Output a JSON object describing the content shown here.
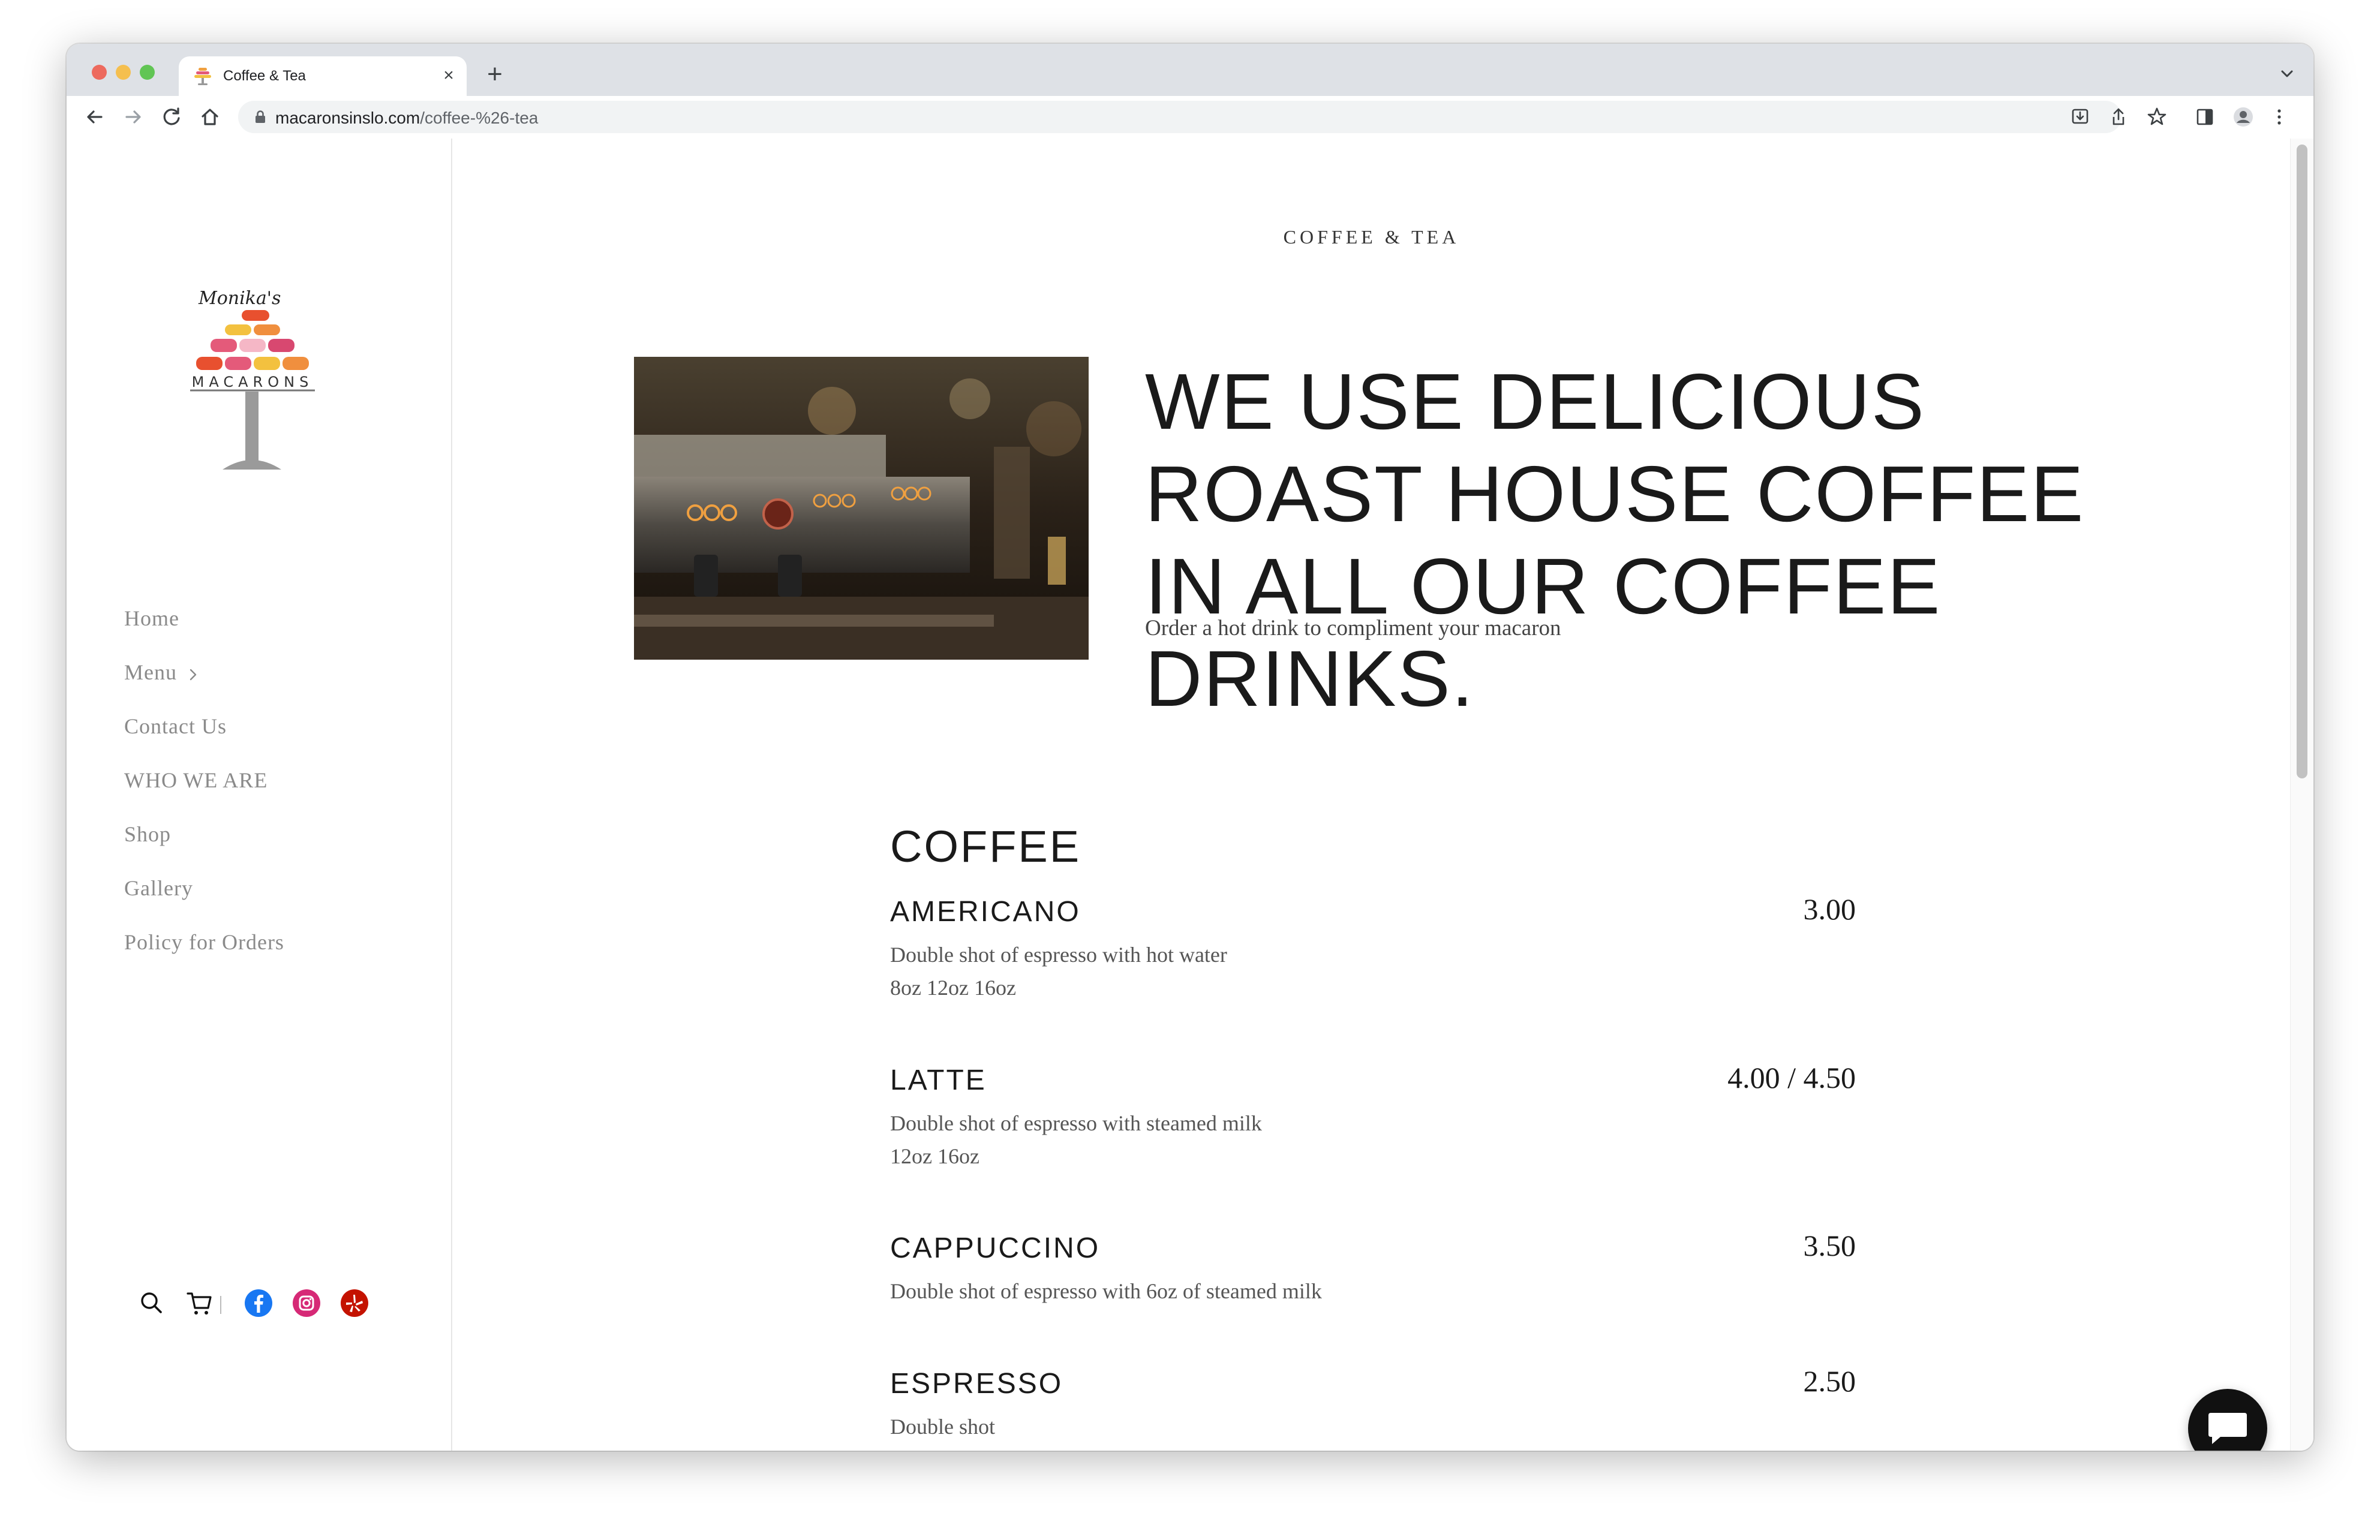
{
  "browser": {
    "tab_title": "Coffee & Tea",
    "tab_close": "×",
    "new_tab": "+",
    "url_host": "macaronsinslo.com",
    "url_path": "/coffee-%26-tea",
    "traffic_lights": [
      "#ed6a5e",
      "#f5bf4f",
      "#61c554"
    ]
  },
  "brand": {
    "logo_script": "Monika's",
    "logo_text": "MACARONS"
  },
  "sidebar": {
    "nav": [
      {
        "label": "Home"
      },
      {
        "label": "Menu",
        "has_submenu": true
      },
      {
        "label": "Contact Us"
      },
      {
        "label": "WHO WE ARE"
      },
      {
        "label": "Shop"
      },
      {
        "label": "Gallery"
      },
      {
        "label": "Policy for Orders"
      }
    ],
    "icons": [
      "search-icon",
      "cart-icon",
      "facebook-icon",
      "instagram-icon",
      "yelp-icon"
    ]
  },
  "page": {
    "eyebrow": "COFFEE & TEA",
    "hero_title": "WE USE DELICIOUS ROAST HOUSE COFFEE IN ALL OUR COFFEE DRINKS.",
    "hero_subtitle": "Order a hot drink to compliment your macaron",
    "section_title": "COFFEE",
    "items": [
      {
        "name": "AMERICANO",
        "price": "3.00",
        "description": "Double shot of espresso with hot water",
        "sizes": "8oz  12oz  16oz"
      },
      {
        "name": "LATTE",
        "price": "4.00 / 4.50",
        "description": "Double shot of espresso with steamed milk",
        "sizes": "12oz  16oz"
      },
      {
        "name": "CAPPUCCINO",
        "price": "3.50",
        "description": "Double shot of espresso with 6oz of steamed milk",
        "sizes": ""
      },
      {
        "name": "ESPRESSO",
        "price": "2.50",
        "description": "Double shot",
        "sizes": ""
      }
    ]
  },
  "colors": {
    "nav_text": "#8a8a8a",
    "heading": "#1a1a1a",
    "facebook": "#1877f2",
    "instagram": "#d62976",
    "yelp": "#c41200"
  }
}
